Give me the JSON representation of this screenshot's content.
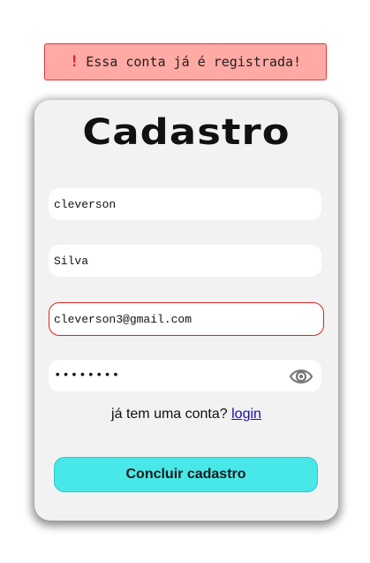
{
  "alert": {
    "icon": "!",
    "message": "Essa conta já é registrada!",
    "color": "#ffaaa5"
  },
  "form": {
    "title": "Cadastro",
    "first_name": "cleverson",
    "last_name": "Silva",
    "email": "cleverson3@gmail.com",
    "password_masked": "••••••••",
    "eye_icon": "eye-icon"
  },
  "login_prompt": {
    "text": "já tem uma conta?",
    "link_label": "login"
  },
  "submit": {
    "label": "Concluir cadastro",
    "color": "#48e8e8"
  },
  "colors": {
    "error_border": "#e02020",
    "card_background": "#f2f2f2"
  }
}
